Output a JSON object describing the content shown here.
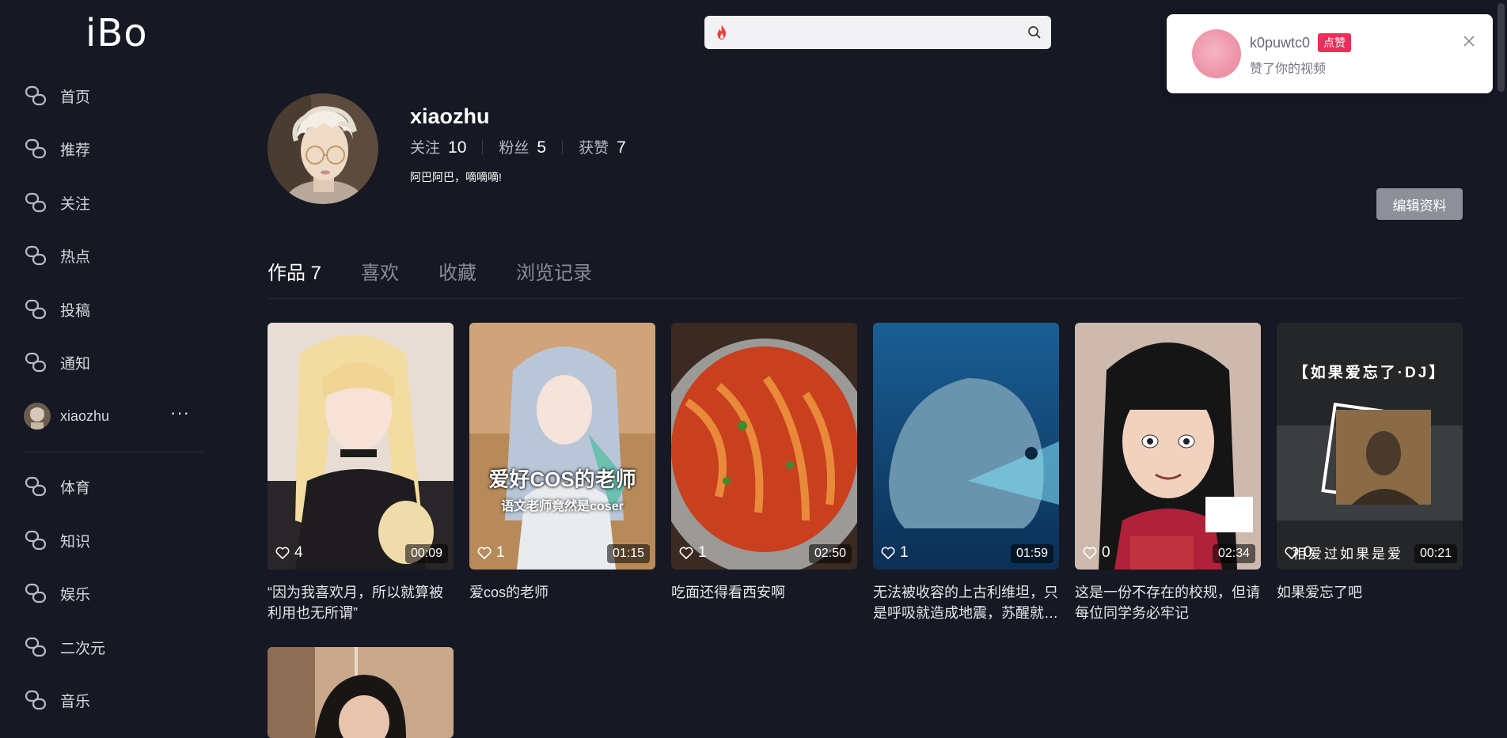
{
  "app": {
    "logo": "iBo"
  },
  "sidebar": {
    "items": [
      {
        "label": "首页"
      },
      {
        "label": "推荐"
      },
      {
        "label": "关注"
      },
      {
        "label": "热点"
      },
      {
        "label": "投稿"
      },
      {
        "label": "通知"
      }
    ],
    "user": {
      "name": "xiaozhu",
      "more": "···"
    },
    "categories": [
      {
        "label": "体育"
      },
      {
        "label": "知识"
      },
      {
        "label": "娱乐"
      },
      {
        "label": "二次元"
      },
      {
        "label": "音乐"
      }
    ]
  },
  "search": {
    "value": "",
    "placeholder": ""
  },
  "profile": {
    "name": "xiaozhu",
    "stats": {
      "following_label": "关注",
      "following": "10",
      "fans_label": "粉丝",
      "fans": "5",
      "likes_label": "获赞",
      "likes": "7"
    },
    "bio": "阿巴阿巴，嘀嘀嘀!",
    "edit_label": "编辑资料"
  },
  "tabs": [
    {
      "label": "作品 7",
      "active": true
    },
    {
      "label": "喜欢"
    },
    {
      "label": "收藏"
    },
    {
      "label": "浏览记录"
    }
  ],
  "videos": [
    {
      "likes": "4",
      "duration": "00:09",
      "title": "“因为我喜欢月，所以就算被利用也无所谓”"
    },
    {
      "likes": "1",
      "duration": "01:15",
      "title": "爱cos的老师",
      "overlay_main": "爱好COS的老师",
      "overlay_sub": "语文老师竟然是coser"
    },
    {
      "likes": "1",
      "duration": "02:50",
      "title": "吃面还得看西安啊"
    },
    {
      "likes": "1",
      "duration": "01:59",
      "title": "无法被收容的上古利维坦，只是呼吸就造成地震，苏醒就…"
    },
    {
      "likes": "0",
      "duration": "02:34",
      "title": "这是一份不存在的校规，但请每位同学务必牢记"
    },
    {
      "likes": "0",
      "duration": "00:21",
      "title": "如果爱忘了吧",
      "overlay_top": "【如果爱忘了·DJ】",
      "overlay_bottom": "相爱过如果是爱"
    }
  ],
  "notification": {
    "user": "k0puwtc0",
    "badge": "点赞",
    "message": "赞了你的视频"
  },
  "colors": {
    "background": "#161823",
    "badge": "#ee2d5b",
    "edit_button": "#8e9099"
  }
}
